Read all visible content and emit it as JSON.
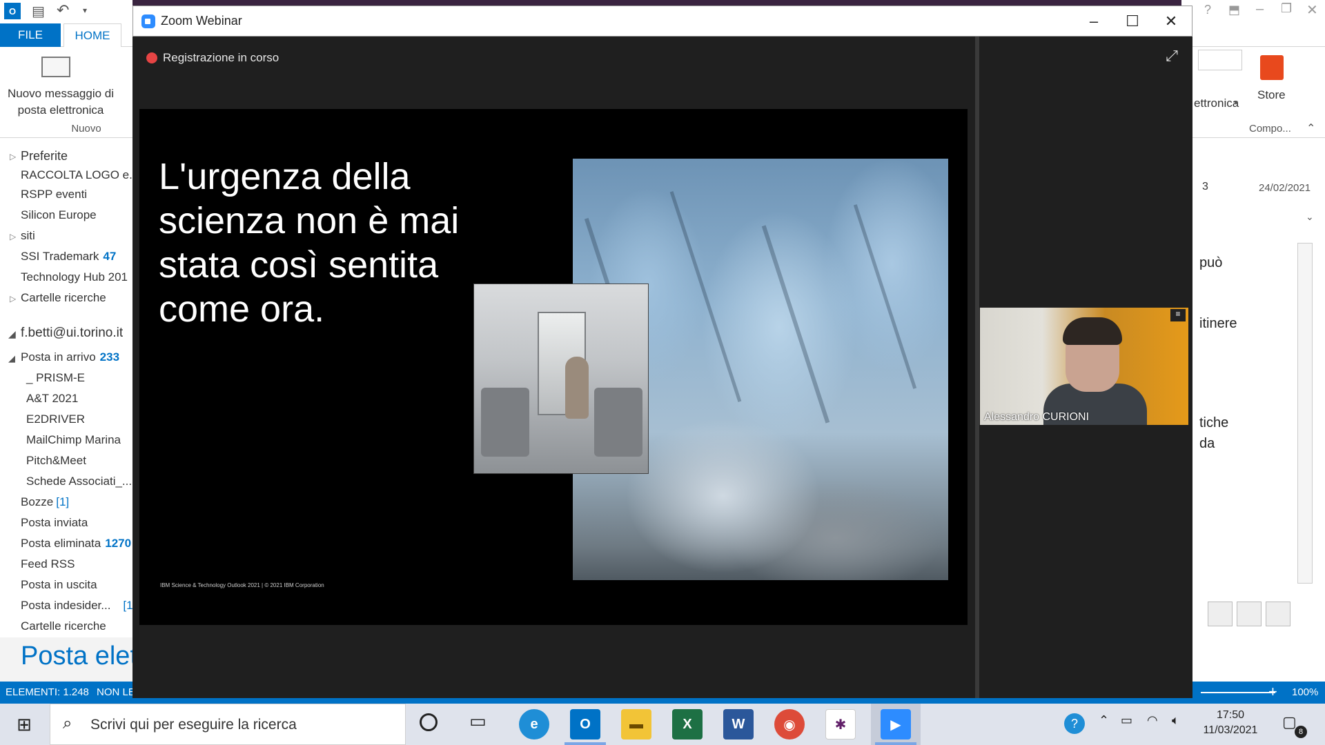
{
  "outlook": {
    "tabs": {
      "file": "FILE",
      "home": "HOME"
    },
    "ribbon": {
      "new_message": "Nuovo messaggio di posta elettronica",
      "new_group": "Nuovo",
      "store": "Store",
      "electronic_partial": "ettronica",
      "compose_partial": "Compo..."
    },
    "sidebar": {
      "preferite": "Preferite",
      "raccolta": "RACCOLTA LOGO e...",
      "rspp": "RSPP eventi",
      "silicon": "Silicon Europe",
      "siti": "siti",
      "ssi": "SSI Trademark",
      "ssi_count": "47",
      "techhub": "Technology Hub 201",
      "cartelle1": "Cartelle ricerche",
      "account": "f.betti@ui.torino.it",
      "inbox": "Posta in arrivo",
      "inbox_count": "233",
      "prism": "_ PRISM-E",
      "at": "A&T 2021",
      "e2d": "E2DRIVER",
      "mailchimp": "MailChimp Marina",
      "pitch": "Pitch&Meet",
      "schede": "Schede Associati_...",
      "bozze": "Bozze",
      "bozze_count": "[1]",
      "inviata": "Posta inviata",
      "eliminata": "Posta eliminata",
      "eliminata_count": "1270",
      "rss": "Feed RSS",
      "uscita": "Posta in uscita",
      "indesiderata": "Posta indesider...",
      "indesiderata_count": "[1",
      "cartelle2": "Cartelle ricerche"
    },
    "section_title": "Posta elett",
    "status": {
      "items": "ELEMENTI: 1.248",
      "non_letti": "NON LE",
      "zoom": "100%"
    },
    "reading": {
      "date": "24/02/2021",
      "count": "3",
      "t1": "può",
      "t2": "itinere",
      "t3": "tiche",
      "t4": "da"
    }
  },
  "zoom": {
    "window_title": "Zoom Webinar",
    "recording": "Registrazione in corso",
    "slide": {
      "headline": "L'urgenza della scienza non è mai stata così sentita come ora.",
      "footer": "IBM Science & Technology Outlook 2021 | © 2021 IBM Corporation"
    },
    "participant": "Alessandro CURIONI"
  },
  "taskbar": {
    "search_placeholder": "Scrivi qui per eseguire la ricerca",
    "time": "17:50",
    "date": "11/03/2021",
    "notif_count": "8"
  }
}
